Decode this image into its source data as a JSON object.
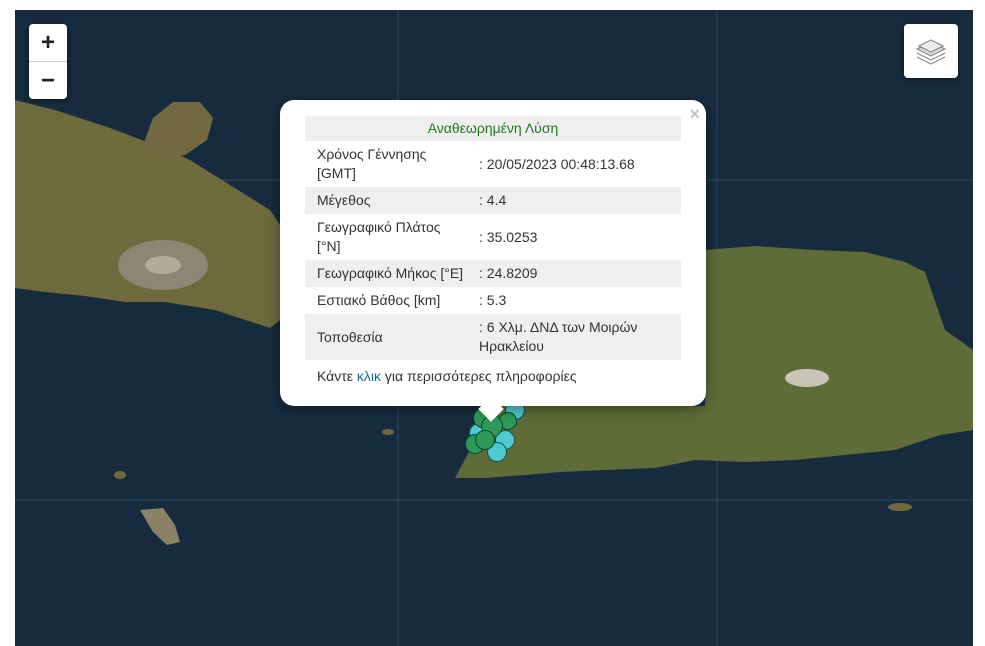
{
  "zoom": {
    "in_label": "+",
    "out_label": "−"
  },
  "popup": {
    "close_label": "×",
    "header": "Αναθεωρημένη Λύση",
    "rows": [
      {
        "label": "Χρόνος Γέννησης [GMT]",
        "value": ": 20/05/2023 00:48:13.68"
      },
      {
        "label": "Μέγεθος",
        "value": ": 4.4"
      },
      {
        "label": "Γεωγραφικό Πλάτος [°N]",
        "value": ": 35.0253"
      },
      {
        "label": "Γεωγραφικό Μήκος [°E]",
        "value": ": 24.8209"
      },
      {
        "label": "Εστιακό Βάθος [km]",
        "value": ": 5.3"
      },
      {
        "label": "Τοποθεσία",
        "value": ": 6 Χλμ. ΔΝΔ των Μοιρών Ηρακλείου"
      }
    ],
    "more_prefix": "Κάντε ",
    "more_link": "κλικ",
    "more_suffix": " για περισσότερες πληροφορίες"
  },
  "colors": {
    "sea": "#152b3c",
    "land": "#6f6a3e",
    "marker_green": "#2f9a58",
    "marker_cyan": "#4ec9cf",
    "header_green": "#1c7a1c",
    "link": "#1a6ca5"
  },
  "icons": {
    "layers": "layers-icon",
    "close": "close-icon"
  }
}
